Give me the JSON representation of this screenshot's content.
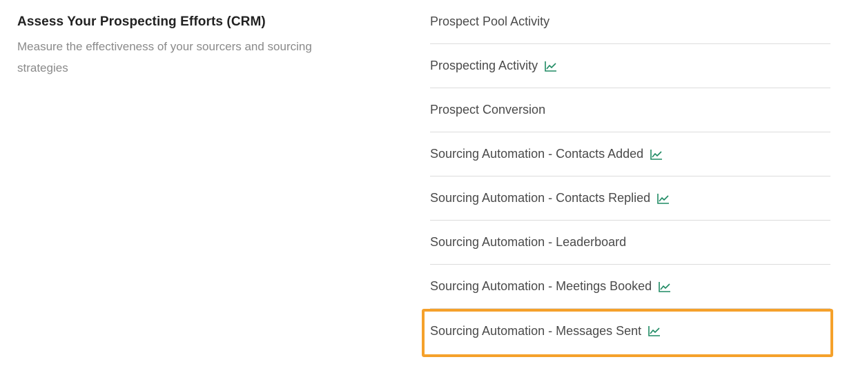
{
  "section": {
    "title": "Assess Your Prospecting Efforts (CRM)",
    "description": "Measure the effectiveness of your sourcers and sourcing strategies"
  },
  "reports": [
    {
      "label": "Prospect Pool Activity",
      "icon": "none"
    },
    {
      "label": "Prospecting Activity",
      "icon": "trend-chart-icon"
    },
    {
      "label": "Prospect Conversion",
      "icon": "none"
    },
    {
      "label": "Sourcing Automation - Contacts Added",
      "icon": "trend-chart-icon"
    },
    {
      "label": "Sourcing Automation - Contacts Replied",
      "icon": "trend-chart-icon"
    },
    {
      "label": "Sourcing Automation - Leaderboard",
      "icon": "none"
    },
    {
      "label": "Sourcing Automation - Meetings Booked",
      "icon": "trend-chart-icon"
    },
    {
      "label": "Sourcing Automation - Messages Sent",
      "icon": "trend-chart-icon"
    }
  ],
  "colors": {
    "icon": "#1f8a63",
    "highlight": "#f5a12b",
    "title": "#222222",
    "description": "#8a8a8a",
    "item_text": "#4a4a4a",
    "divider": "#dcdcdc"
  },
  "highlighted_report": "Sourcing Automation - Messages Sent"
}
